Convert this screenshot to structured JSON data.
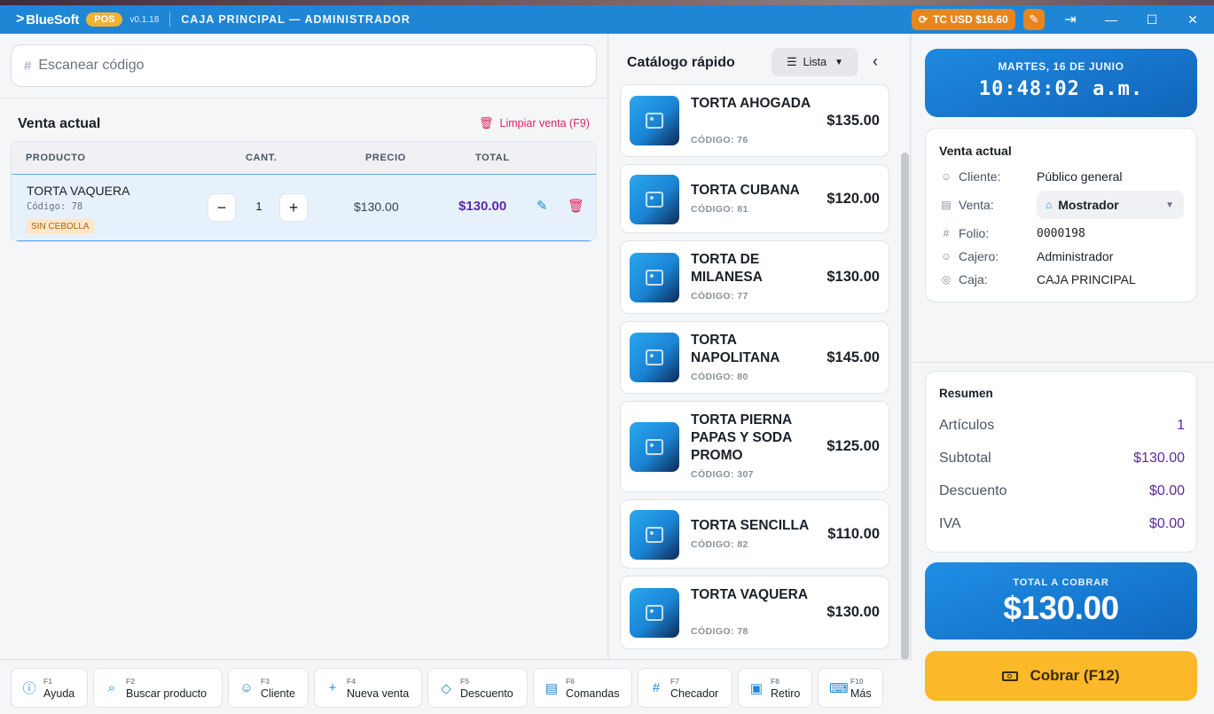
{
  "app": {
    "brand": "BlueSoft",
    "badge": "POS",
    "version": "v0.1.18",
    "title": "CAJA PRINCIPAL — ADMINISTRADOR",
    "exchange_rate": "TC USD $16.60"
  },
  "scan": {
    "placeholder": "Escanear código"
  },
  "sale": {
    "title": "Venta actual",
    "clear_label": "Limpiar venta (F9)",
    "columns": [
      "PRODUCTO",
      "CANT.",
      "PRECIO",
      "TOTAL"
    ],
    "items": [
      {
        "name": "TORTA VAQUERA",
        "code": "Código: 78",
        "note": "SIN CEBOLLA",
        "qty": "1",
        "price": "$130.00",
        "total": "$130.00"
      }
    ]
  },
  "catalog": {
    "title": "Catálogo rápido",
    "view_label": "Lista",
    "products": [
      {
        "name": "TORTA AHOGADA",
        "code": "CÓDIGO: 76",
        "price": "$135.00"
      },
      {
        "name": "TORTA CUBANA",
        "code": "CÓDIGO: 81",
        "price": "$120.00"
      },
      {
        "name": "TORTA DE MILANESA",
        "code": "CÓDIGO: 77",
        "price": "$130.00"
      },
      {
        "name": "TORTA NAPOLITANA",
        "code": "CÓDIGO: 80",
        "price": "$145.00"
      },
      {
        "name": "TORTA PIERNA PAPAS Y SODA PROMO",
        "code": "CÓDIGO: 307",
        "price": "$125.00"
      },
      {
        "name": "TORTA SENCILLA",
        "code": "CÓDIGO: 82",
        "price": "$110.00"
      },
      {
        "name": "TORTA VAQUERA",
        "code": "CÓDIGO: 78",
        "price": "$130.00"
      }
    ]
  },
  "clock": {
    "date": "MARTES, 16 DE JUNIO",
    "time": "10:48:02 a.m."
  },
  "info": {
    "title": "Venta actual",
    "cliente_label": "Cliente:",
    "cliente": "Público general",
    "venta_label": "Venta:",
    "venta": "Mostrador",
    "folio_label": "Folio:",
    "folio": "0000198",
    "cajero_label": "Cajero:",
    "cajero": "Administrador",
    "caja_label": "Caja:",
    "caja": "CAJA PRINCIPAL"
  },
  "summary": {
    "title": "Resumen",
    "articulos_label": "Artículos",
    "articulos": "1",
    "subtotal_label": "Subtotal",
    "subtotal": "$130.00",
    "descuento_label": "Descuento",
    "descuento": "$0.00",
    "iva_label": "IVA",
    "iva": "$0.00"
  },
  "total": {
    "label": "TOTAL A COBRAR",
    "value": "$130.00"
  },
  "cobrar_label": "Cobrar (F12)",
  "shortcuts": [
    {
      "key": "F1",
      "label": "Ayuda",
      "icon": "help-icon"
    },
    {
      "key": "F2",
      "label": "Buscar producto",
      "icon": "search-icon"
    },
    {
      "key": "F3",
      "label": "Cliente",
      "icon": "user-icon"
    },
    {
      "key": "F4",
      "label": "Nueva venta",
      "icon": "plus-icon"
    },
    {
      "key": "F5",
      "label": "Descuento",
      "icon": "tag-icon"
    },
    {
      "key": "F6",
      "label": "Comandas",
      "icon": "clipboard-icon"
    },
    {
      "key": "F7",
      "label": "Checador",
      "icon": "hash-icon"
    },
    {
      "key": "F8",
      "label": "Retiro",
      "icon": "wallet-icon"
    },
    {
      "key": "F10",
      "label": "Más",
      "icon": "keyboard-icon"
    }
  ],
  "colors": {
    "primary": "#1f86d6",
    "accent": "#5b2aa8",
    "warning": "#fbb828",
    "danger": "#e0245e"
  }
}
